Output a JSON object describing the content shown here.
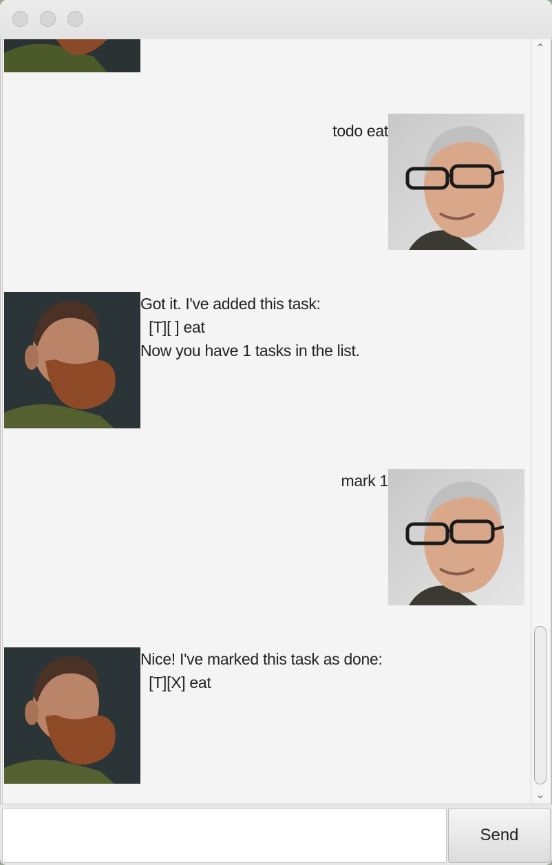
{
  "window": {
    "controls": [
      "close",
      "minimize",
      "maximize"
    ]
  },
  "dialog": [
    {
      "role": "bot",
      "avatar": "bearded-man-avatar",
      "text": ""
    },
    {
      "role": "user",
      "avatar": "man-with-glasses-avatar",
      "text": "todo eat"
    },
    {
      "role": "bot",
      "avatar": "bearded-man-avatar",
      "text": "Got it. I've added this task:\n  [T][ ] eat\nNow you have 1 tasks in the list."
    },
    {
      "role": "user",
      "avatar": "man-with-glasses-avatar",
      "text": "mark 1"
    },
    {
      "role": "bot",
      "avatar": "bearded-man-avatar",
      "text": "Nice! I've marked this task as done:\n  [T][X] eat"
    }
  ],
  "input": {
    "value": "",
    "placeholder": ""
  },
  "send_button": {
    "label": "Send"
  },
  "colors": {
    "background": "#f4f4f4",
    "titlebar": "#e5e5e5",
    "text": "#222222"
  }
}
